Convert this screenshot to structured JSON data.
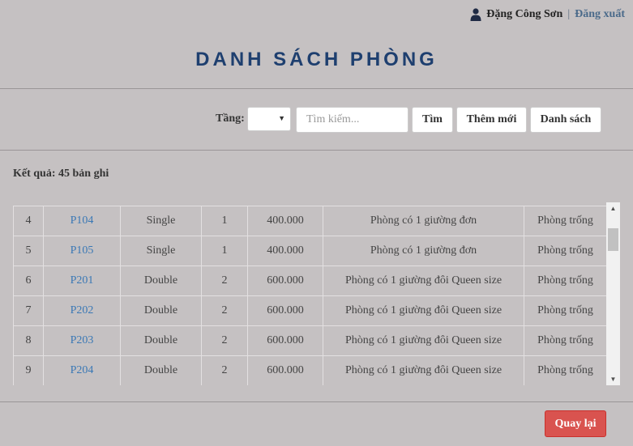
{
  "header": {
    "user_name": "Đặng Công Sơn",
    "separator": "|",
    "logout_label": "Đăng xuất",
    "user_icon": "user-icon"
  },
  "page_title": "DANH SÁCH PHÒNG",
  "toolbar": {
    "floor_label": "Tầng:",
    "floor_value": "",
    "search_placeholder": "Tìm kiếm...",
    "search_label": "Tìm",
    "add_label": "Thêm mới",
    "list_label": "Danh sách"
  },
  "result_text": "Kết quả: 45 bản ghi",
  "rows": [
    {
      "stt": "4",
      "code": "P104",
      "type": "Single",
      "beds": "1",
      "price": "400.000",
      "desc": "Phòng có 1 giường đơn",
      "status": "Phòng trống"
    },
    {
      "stt": "5",
      "code": "P105",
      "type": "Single",
      "beds": "1",
      "price": "400.000",
      "desc": "Phòng có 1 giường đơn",
      "status": "Phòng trống"
    },
    {
      "stt": "6",
      "code": "P201",
      "type": "Double",
      "beds": "2",
      "price": "600.000",
      "desc": "Phòng có 1 giường đôi Queen size",
      "status": "Phòng trống"
    },
    {
      "stt": "7",
      "code": "P202",
      "type": "Double",
      "beds": "2",
      "price": "600.000",
      "desc": "Phòng có 1 giường đôi Queen size",
      "status": "Phòng trống"
    },
    {
      "stt": "8",
      "code": "P203",
      "type": "Double",
      "beds": "2",
      "price": "600.000",
      "desc": "Phòng có 1 giường đôi Queen size",
      "status": "Phòng trống"
    },
    {
      "stt": "9",
      "code": "P204",
      "type": "Double",
      "beds": "2",
      "price": "600.000",
      "desc": "Phòng có 1 giường đôi Queen size",
      "status": "Phòng trống"
    }
  ],
  "footer": {
    "back_label": "Quay lại",
    "back_color": "#d9534f"
  },
  "colors": {
    "background": "#c5c1c2",
    "title": "#1e3f6f",
    "link": "#3a78b5"
  }
}
